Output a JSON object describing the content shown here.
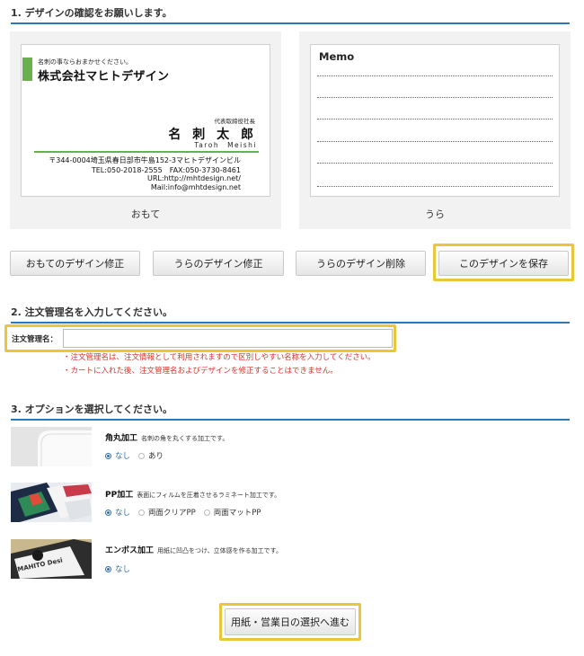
{
  "step1": {
    "title": "1. デザインの確認をお願いします。",
    "front": {
      "label": "おもて",
      "tagline": "名刺の事ならおまかせください。",
      "company": "株式会社マヒトデザイン",
      "position": "代表取締役社長",
      "name": "名 刺 太 郎",
      "name_roman": "Taroh　Meishi",
      "address": "〒344-0004埼玉県春日部市牛島152-3マヒトデザインビル",
      "tel_fax": "TEL:050-2018-2555　FAX:050-3730-8461",
      "url": "URL:http://mhtdesign.net/",
      "mail": "Mail:info@mhtdesign.net"
    },
    "back": {
      "label": "うら",
      "memo_title": "Memo"
    },
    "buttons": {
      "edit_front": "おもてのデザイン修正",
      "edit_back": "うらのデザイン修正",
      "delete_back": "うらのデザイン削除",
      "save": "このデザインを保存"
    }
  },
  "step2": {
    "title": "2. 注文管理名を入力してください。",
    "label": "注文管理名：",
    "value": "",
    "notes": [
      "・注文管理名は、注文情報として利用されますので区別しやすい名称を入力してください。",
      "・カートに入れた後、注文管理名およびデザインを修正することはできません。"
    ]
  },
  "step3": {
    "title": "3. オプションを選択してください。",
    "options": [
      {
        "name": "角丸加工",
        "desc": "名刺の角を丸くする加工です。",
        "choices": [
          "なし",
          "あり"
        ],
        "selected": "なし"
      },
      {
        "name": "PP加工",
        "desc": "表面にフィルムを圧着させるラミネート加工です。",
        "choices": [
          "なし",
          "両面クリアPP",
          "両面マットPP"
        ],
        "selected": "なし"
      },
      {
        "name": "エンボス加工",
        "desc": "用紙に凹凸をつけ、立体感を作る加工です。",
        "choices": [
          "なし"
        ],
        "selected": "なし"
      }
    ],
    "emboss_thumb_text": "MAHITO Desi"
  },
  "next_button": "用紙・営業日の選択へ進む",
  "colors": {
    "section_rule": "#2a7ab8",
    "highlight": "#eac63a",
    "note_red": "#d8332b",
    "card_green": "#6ab04c",
    "radio_blue": "#2a6fb0"
  }
}
